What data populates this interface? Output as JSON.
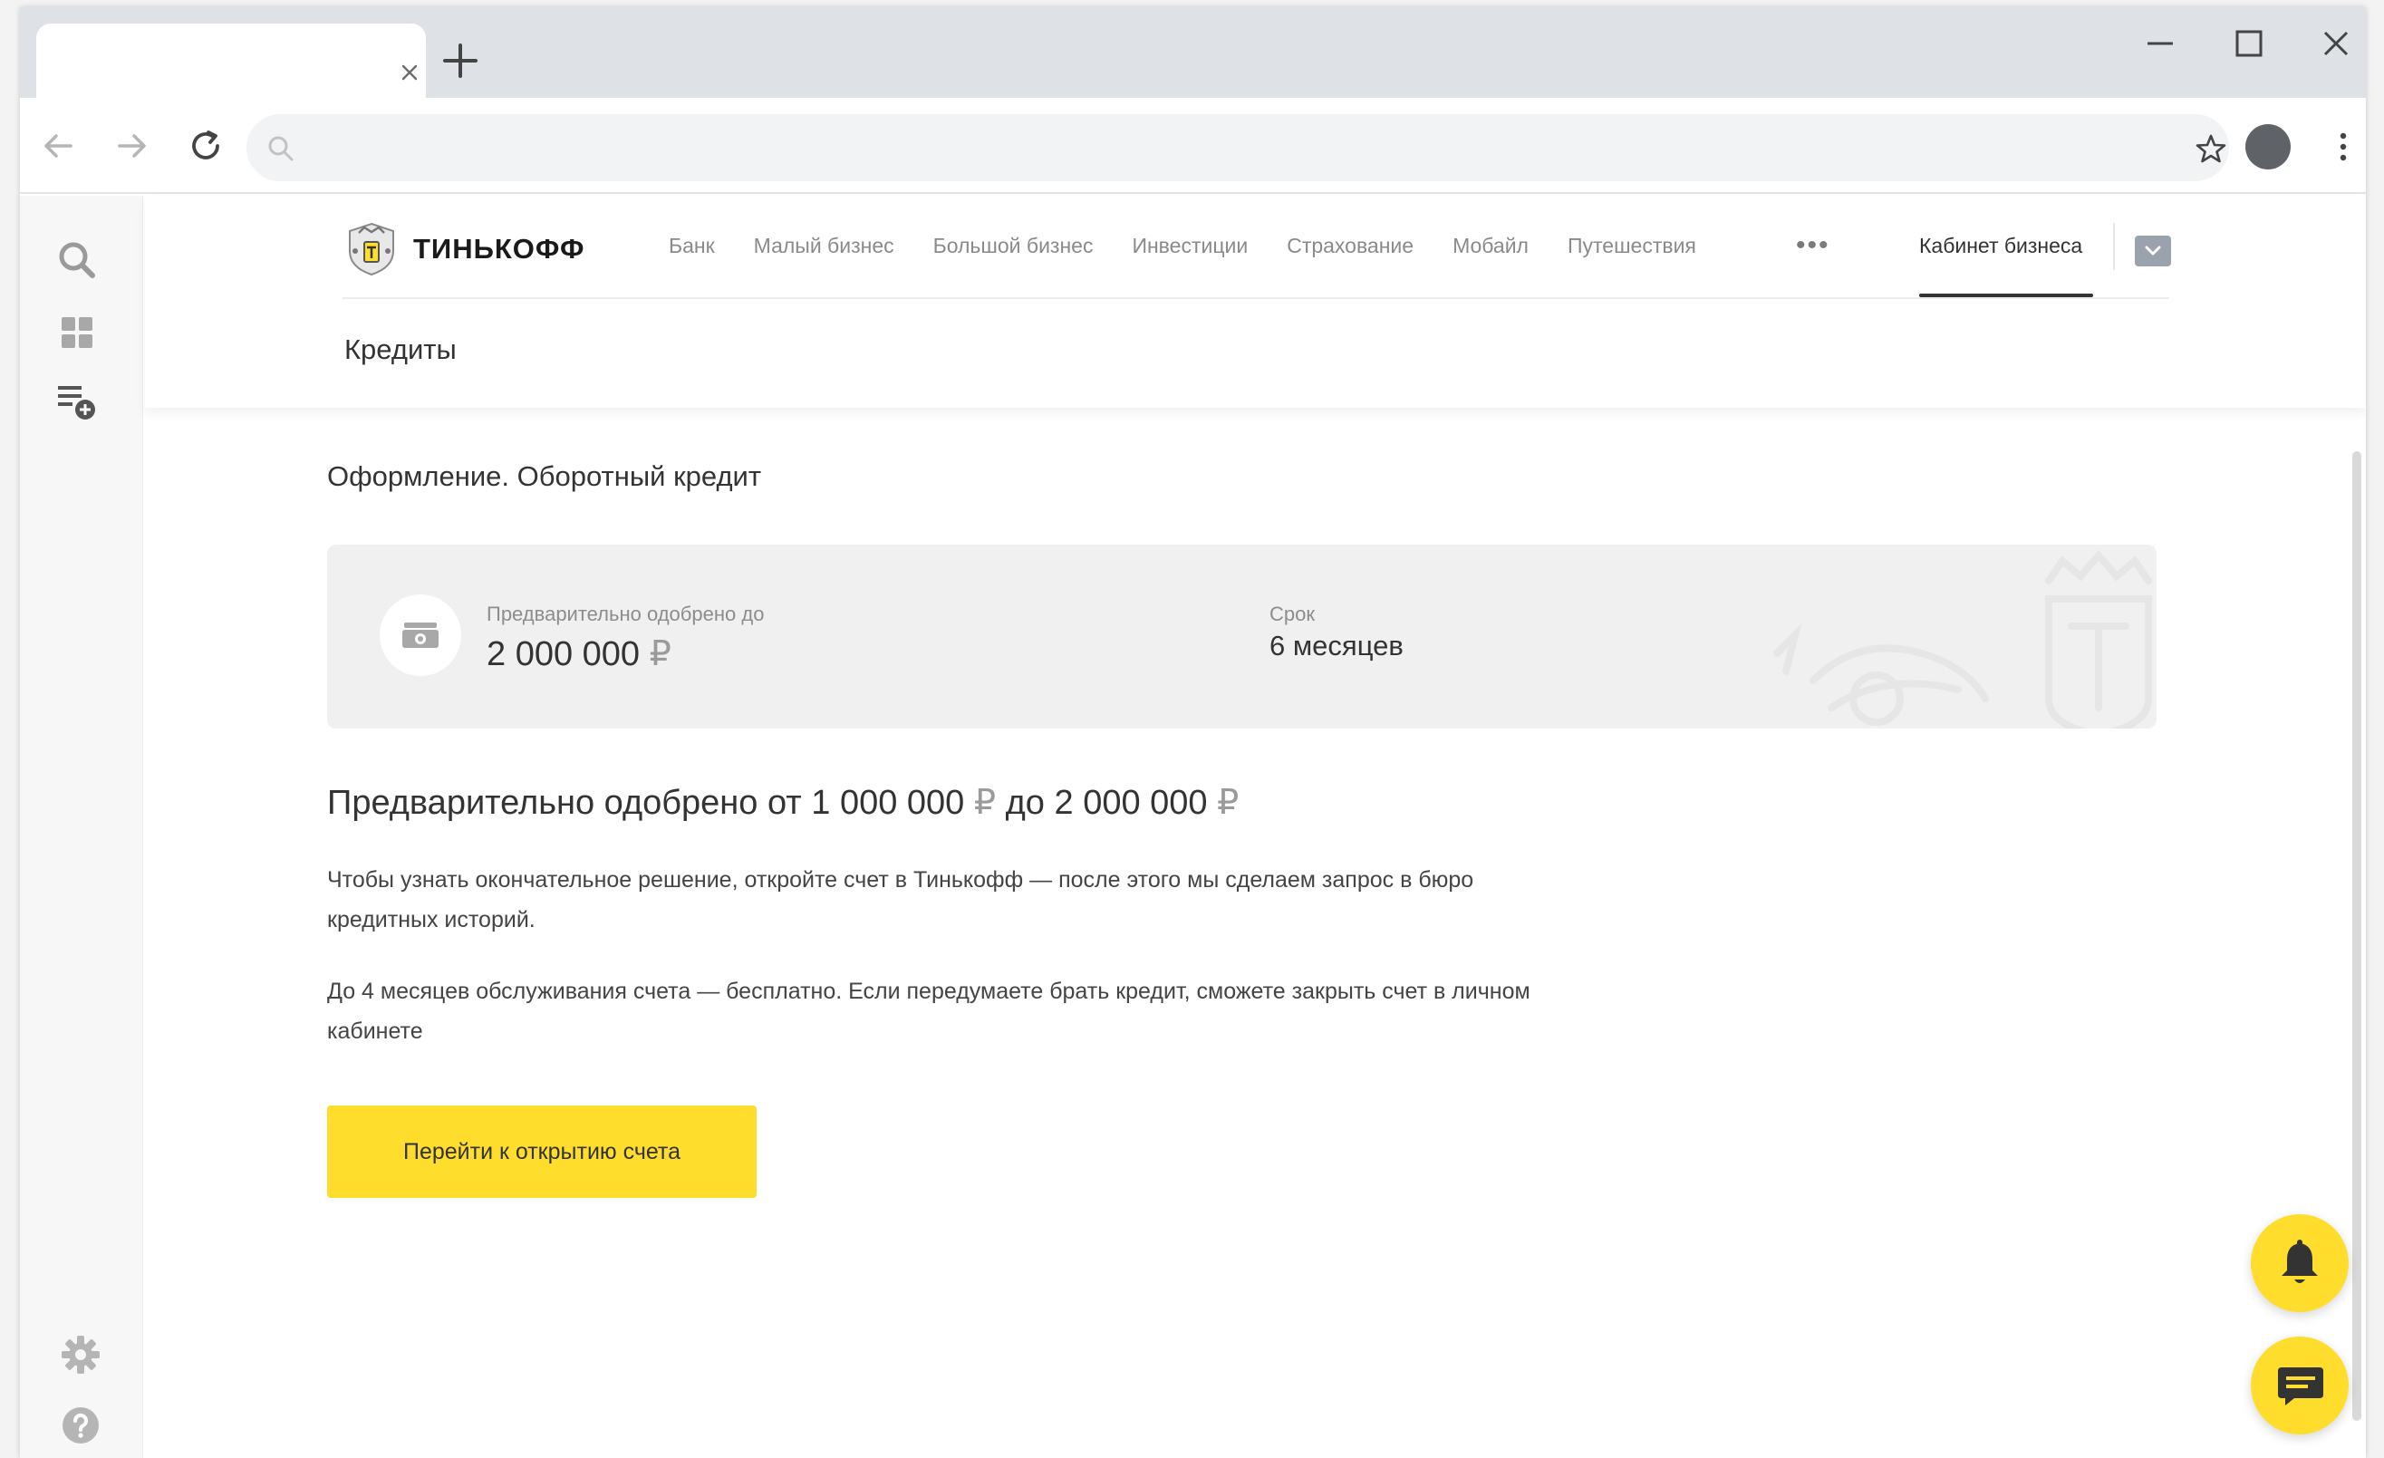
{
  "browser": {
    "tab_title": "",
    "url": ""
  },
  "page": {
    "brand": "ТИНЬКОФФ",
    "nav": [
      "Банк",
      "Малый бизнес",
      "Большой бизнес",
      "Инвестиции",
      "Страхование",
      "Мобайл",
      "Путешествия"
    ],
    "nav_more": "•••",
    "cabinet": "Кабинет бизнеса",
    "section_title": "Кредиты",
    "heading": "Оформление. Оборотный кредит",
    "card": {
      "approved_label": "Предварительно одобрено до",
      "approved_value": "2 000 000",
      "currency": "₽",
      "term_label": "Срок",
      "term_value": "6 месяцев"
    },
    "subheading": {
      "prefix": "Предварительно одобрено от",
      "from": "1 000 000",
      "mid": "до",
      "to": "2 000 000",
      "currency": "₽"
    },
    "para1": "Чтобы узнать окончательное решение, откройте счет в Тинькофф — после этого мы сделаем запрос в бюро кредитных историй.",
    "para2": "До 4 месяцев обслуживания счета — бесплатно. Если передумаете брать кредит, сможете закрыть счет в личном кабинете",
    "cta_label": "Перейти к открытию счета"
  },
  "icons": {
    "sidebar": [
      "search-icon",
      "grid-icon",
      "add-list-icon",
      "gear-icon",
      "help-icon"
    ],
    "fabs": [
      "bell-icon",
      "chat-icon"
    ]
  },
  "colors": {
    "accent_yellow": "#ffdd2d",
    "text_primary": "#333333",
    "text_muted": "#8c8c8c",
    "card_bg": "#f0f0f0"
  }
}
